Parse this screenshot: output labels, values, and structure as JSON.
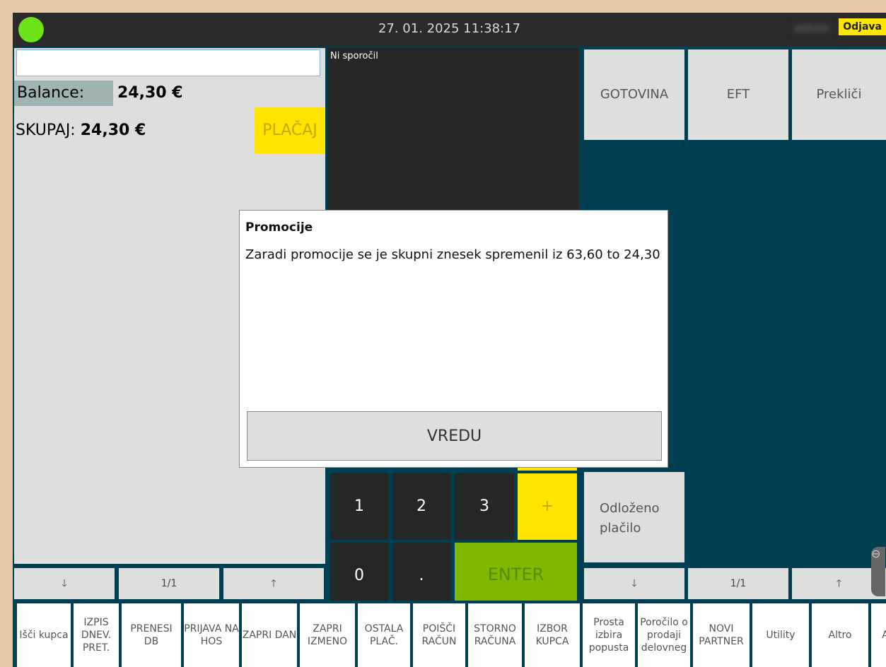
{
  "header": {
    "datetime": "27. 01. 2025 11:38:17",
    "user": "admin",
    "logout": "Odjava"
  },
  "left": {
    "search_placeholder": "",
    "balance_label": "Balance:",
    "balance_value": "24,30 €",
    "total_label": "SKUPAJ:",
    "total_value": "24,30 €",
    "pay": "PLAČAJ",
    "nav": {
      "down": "🡓",
      "page": "1/1",
      "up": "🡑"
    }
  },
  "messages": {
    "empty": "Ni sporočil"
  },
  "right": {
    "cash": "GOTOVINA",
    "eft": "EFT",
    "cancel": "Prekliči",
    "deferred": "Odloženo plačilo",
    "nav": {
      "down": "🡓",
      "page": "1/1",
      "up": "🡑"
    }
  },
  "keypad": {
    "k1": "1",
    "k2": "2",
    "k3": "3",
    "plus": "+",
    "k0": "0",
    "dot": ".",
    "enter": "ENTER"
  },
  "dialog": {
    "title": "Promocije",
    "message": "Zaradi promocije se je skupni znesek spremenil iz 63,60 to 24,30",
    "ok": "VREDU"
  },
  "bottom": [
    "Išči kupca",
    "IZPIS DNEV. PRET.",
    "PRENESI DB",
    "PRIJAVA NA HOS",
    "ZAPRI DAN",
    "ZAPRI IZMENO",
    "OSTALA PLAČ.",
    "POIŠČI RAČUN",
    "STORNO RAČUNA",
    "IZBOR KUPCA",
    "Prosta izbira popusta",
    "Poročilo o prodaji delovneg",
    "NOVI PARTNER",
    "Utility",
    "Altro",
    "A"
  ]
}
